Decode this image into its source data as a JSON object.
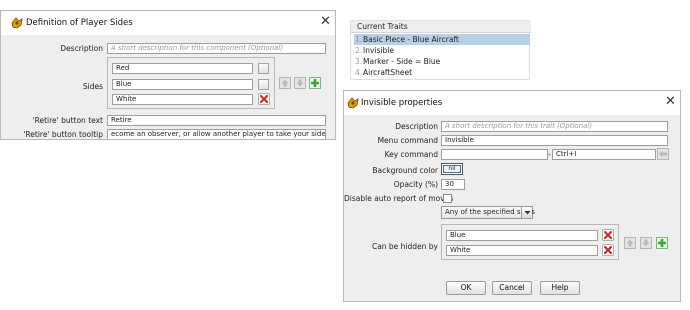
{
  "sides_dialog": {
    "title": "Definition of Player Sides",
    "description_label": "Description",
    "description_placeholder": "A short description for this component (Optional)",
    "sides_label": "Sides",
    "sides": [
      "Red",
      "Blue",
      "White"
    ],
    "retire_text_label": "'Retire' button text",
    "retire_text_value": "Retire",
    "retire_tooltip_label": "'Retire' button tooltip",
    "retire_tooltip_value": "ecome an observer, or allow another player to take your side in this game"
  },
  "traits_panel": {
    "header": "Current Traits",
    "items": [
      {
        "num": "1.",
        "label": "Basic Piece - Blue Aircraft",
        "selected": true
      },
      {
        "num": "2.",
        "label": "Invisible",
        "selected": false
      },
      {
        "num": "3.",
        "label": "Marker - Side = Blue",
        "selected": false
      },
      {
        "num": "4.",
        "label": "AircraftSheet",
        "selected": false
      }
    ]
  },
  "invisible_dialog": {
    "title": "Invisible properties",
    "description_label": "Description",
    "description_placeholder": "A short description for this trait (Optional)",
    "menu_command_label": "Menu command",
    "menu_command_value": "Invisible",
    "key_command_label": "Key command",
    "key_command_value": "Ctrl+I",
    "background_color_label": "Background color",
    "background_color_value": "nil",
    "opacity_label": "Opacity (%)",
    "opacity_value": "30",
    "disable_auto_report_label": "Disable auto report of moves",
    "disable_auto_report_checked": false,
    "sides_mode": "Any of the specified sides",
    "hidden_by_label": "Can be hidden by",
    "hidden_by": [
      "Blue",
      "White"
    ],
    "ok_label": "OK",
    "cancel_label": "Cancel",
    "help_label": "Help"
  },
  "colors": {
    "dialog_bg": "#eeeeee",
    "selection": "#b8cfe5",
    "delete_red": "#cc2b2b",
    "add_green": "#3aa63a"
  }
}
